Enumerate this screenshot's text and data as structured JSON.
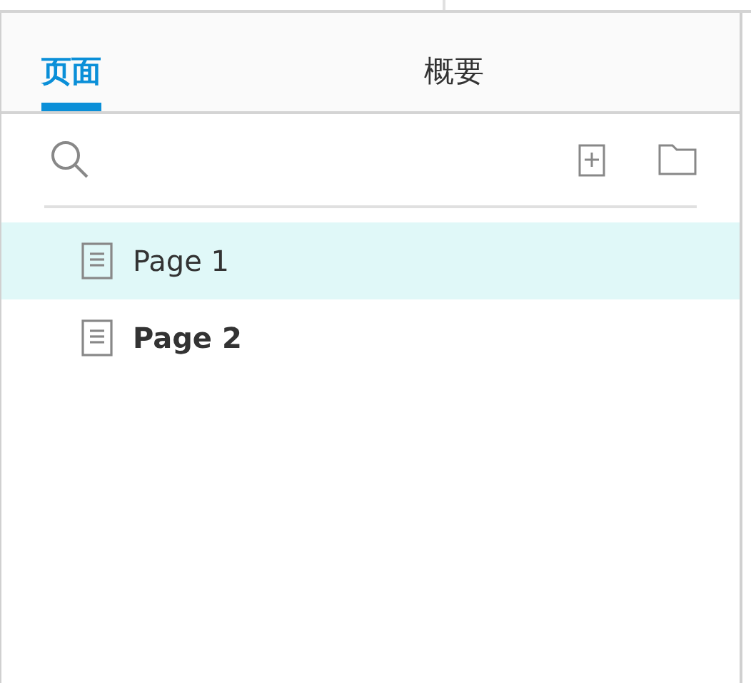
{
  "tabs": [
    {
      "label": "页面",
      "selected": true
    },
    {
      "label": "概要",
      "selected": false
    }
  ],
  "pages": [
    {
      "name": "Page 1",
      "selected": true,
      "bold": false
    },
    {
      "name": "Page 2",
      "selected": false,
      "bold": true
    }
  ]
}
